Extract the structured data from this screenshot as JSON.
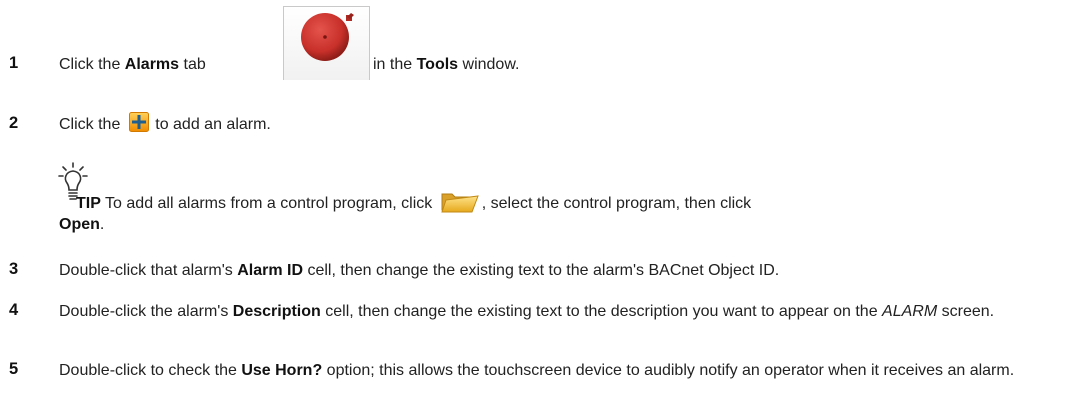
{
  "steps": [
    {
      "number": "1",
      "parts": [
        "Click the ",
        "Alarms",
        " tab",
        " in the ",
        "Tools",
        " window."
      ]
    },
    {
      "number": "2",
      "parts": [
        "Click the ",
        " to add an alarm."
      ]
    },
    {
      "number": "3",
      "parts": [
        "Double-click that alarm's ",
        "Alarm ID",
        " cell, then change the existing text to the alarm's BACnet Object ID."
      ]
    },
    {
      "number": "4",
      "parts": [
        "Double-click the alarm's ",
        "Description",
        " cell, then change the existing text to the description you want to appear on the ",
        "ALARM",
        " screen."
      ]
    },
    {
      "number": "5",
      "parts": [
        "Double-click to check the ",
        "Use Horn?",
        " option; this allows the touchscreen device to audibly notify an operator when it receives an alarm."
      ]
    }
  ],
  "tip": {
    "label": "TIP",
    "parts": [
      " To add all alarms from a control program, click ",
      ", select the control program, then click ",
      "Open",
      "."
    ]
  },
  "icons": {
    "alarm_bell": "alarm-bell-icon",
    "add": "plus-icon",
    "folder": "open-folder-icon",
    "tip": "lightbulb-icon"
  },
  "colors": {
    "bell_red": "#c8302a",
    "plus_orange": "#f4a31a",
    "folder_yellow": "#f3c746"
  }
}
